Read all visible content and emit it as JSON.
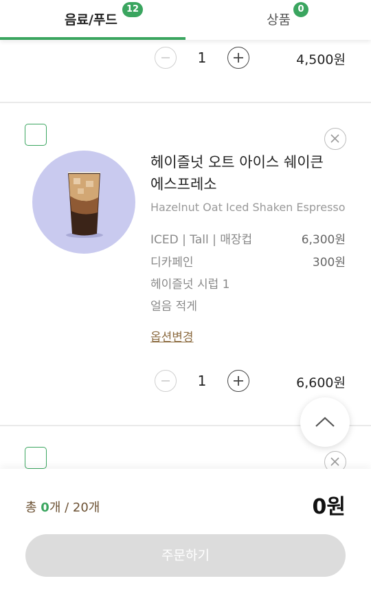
{
  "tabs": [
    {
      "label": "음료/푸드",
      "badge": "12",
      "active": true
    },
    {
      "label": "상품",
      "badge": "0",
      "active": false
    }
  ],
  "items": [
    {
      "quantity": "1",
      "price": "4,500원"
    },
    {
      "name": "헤이즐넛 오트 아이스 쉐이큰 에스프레소",
      "name_line1": "헤이즐넛 오트 아이스 쉐이큰",
      "name_line2": "에스프레소",
      "name_en": "Hazelnut Oat Iced Shaken Espresso",
      "options": [
        {
          "label": "ICED | Tall | 매장컵",
          "price": "6,300원"
        },
        {
          "label": "디카페인",
          "price": "300원"
        },
        {
          "label": "헤이즐넛 시럽 1",
          "price": ""
        },
        {
          "label": "얼음 적게",
          "price": ""
        }
      ],
      "option_change_label": "옵션변경",
      "quantity": "1",
      "price": "6,600원"
    }
  ],
  "footer": {
    "total_prefix": "총 ",
    "total_selected": "0",
    "total_suffix": "개 / 20개",
    "total_price": "0원",
    "order_button": "주문하기"
  },
  "colors": {
    "accent": "#3aa55f",
    "brown": "#6b5032",
    "disabled": "#dcdcdc"
  },
  "icons": [
    "minus-icon",
    "plus-icon",
    "close-icon",
    "chevron-up-icon",
    "product-image"
  ]
}
